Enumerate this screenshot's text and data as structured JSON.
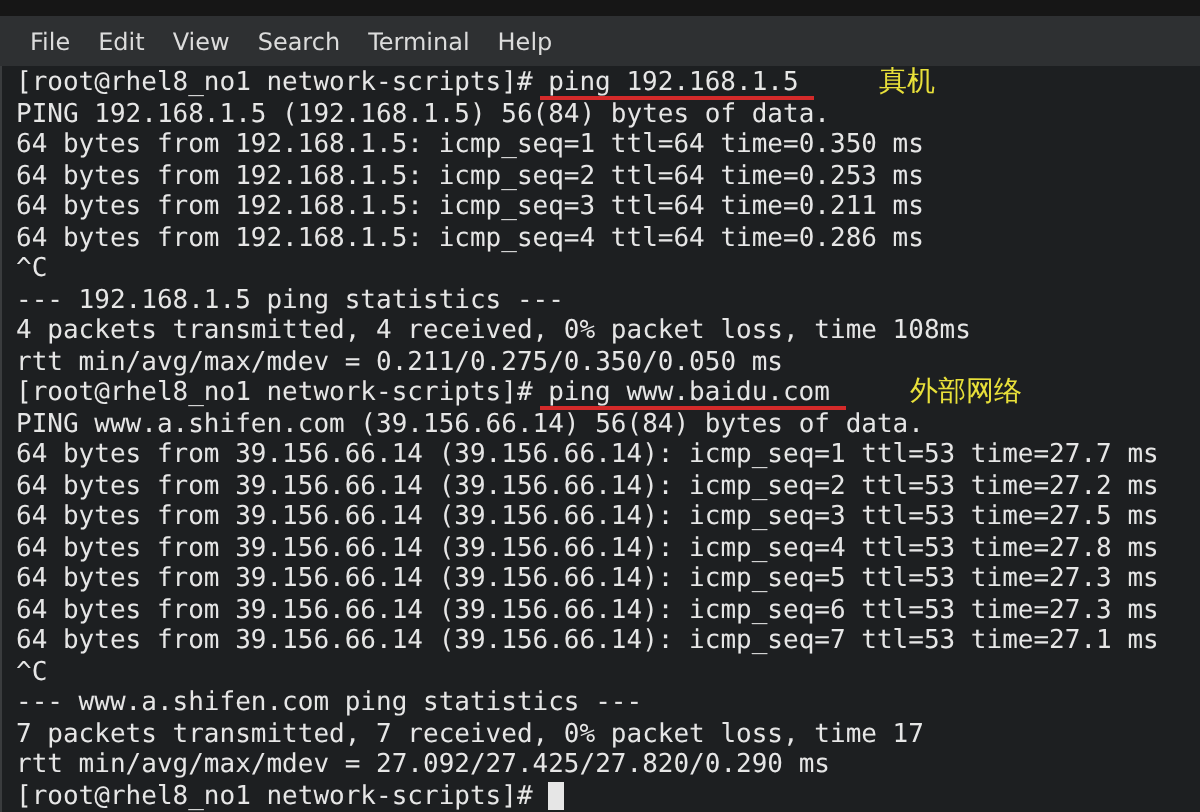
{
  "menu": [
    "File",
    "Edit",
    "View",
    "Search",
    "Terminal",
    "Help"
  ],
  "lines": [
    {
      "kind": "prompt",
      "prompt": "[root@rhel8_no1 network-scripts]#",
      "command": "ping 192.168.1.5",
      "underlined": true,
      "annotation": "真机",
      "cursor": false
    },
    {
      "kind": "output",
      "text": "PING 192.168.1.5 (192.168.1.5) 56(84) bytes of data."
    },
    {
      "kind": "output",
      "text": "64 bytes from 192.168.1.5: icmp_seq=1 ttl=64 time=0.350 ms"
    },
    {
      "kind": "output",
      "text": "64 bytes from 192.168.1.5: icmp_seq=2 ttl=64 time=0.253 ms"
    },
    {
      "kind": "output",
      "text": "64 bytes from 192.168.1.5: icmp_seq=3 ttl=64 time=0.211 ms"
    },
    {
      "kind": "output",
      "text": "64 bytes from 192.168.1.5: icmp_seq=4 ttl=64 time=0.286 ms"
    },
    {
      "kind": "output",
      "text": "^C"
    },
    {
      "kind": "output",
      "text": "--- 192.168.1.5 ping statistics ---"
    },
    {
      "kind": "output",
      "text": "4 packets transmitted, 4 received, 0% packet loss, time 108ms"
    },
    {
      "kind": "output",
      "text": "rtt min/avg/max/mdev = 0.211/0.275/0.350/0.050 ms"
    },
    {
      "kind": "prompt",
      "prompt": "[root@rhel8_no1 network-scripts]#",
      "command": "ping www.baidu.com",
      "underlined": true,
      "annotation": "外部网络",
      "cursor": false
    },
    {
      "kind": "output",
      "text": "PING www.a.shifen.com (39.156.66.14) 56(84) bytes of data."
    },
    {
      "kind": "output",
      "text": "64 bytes from 39.156.66.14 (39.156.66.14): icmp_seq=1 ttl=53 time=27.7 ms"
    },
    {
      "kind": "output",
      "text": "64 bytes from 39.156.66.14 (39.156.66.14): icmp_seq=2 ttl=53 time=27.2 ms"
    },
    {
      "kind": "output",
      "text": "64 bytes from 39.156.66.14 (39.156.66.14): icmp_seq=3 ttl=53 time=27.5 ms"
    },
    {
      "kind": "output",
      "text": "64 bytes from 39.156.66.14 (39.156.66.14): icmp_seq=4 ttl=53 time=27.8 ms"
    },
    {
      "kind": "output",
      "text": "64 bytes from 39.156.66.14 (39.156.66.14): icmp_seq=5 ttl=53 time=27.3 ms"
    },
    {
      "kind": "output",
      "text": "64 bytes from 39.156.66.14 (39.156.66.14): icmp_seq=6 ttl=53 time=27.3 ms"
    },
    {
      "kind": "output",
      "text": "64 bytes from 39.156.66.14 (39.156.66.14): icmp_seq=7 ttl=53 time=27.1 ms"
    },
    {
      "kind": "output",
      "text": "^C"
    },
    {
      "kind": "output",
      "text": "--- www.a.shifen.com ping statistics ---"
    },
    {
      "kind": "output",
      "text": "7 packets transmitted, 7 received, 0% packet loss, time 17"
    },
    {
      "kind": "output",
      "text": "rtt min/avg/max/mdev = 27.092/27.425/27.820/0.290 ms"
    },
    {
      "kind": "prompt",
      "prompt": "[root@rhel8_no1 network-scripts]#",
      "cursor": true,
      "underlined": false
    }
  ]
}
